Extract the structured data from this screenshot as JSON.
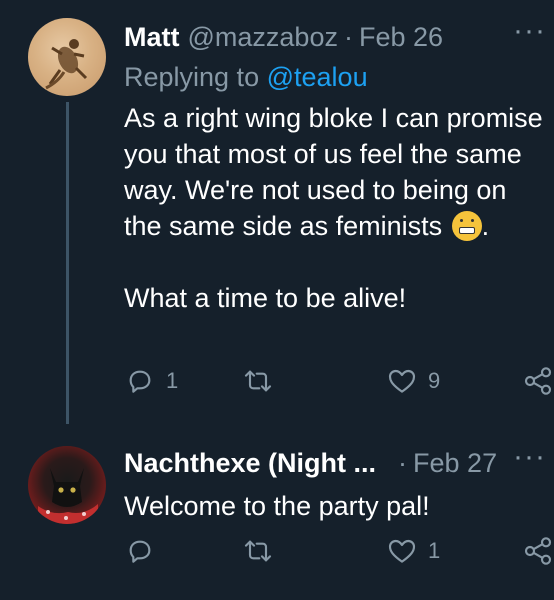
{
  "tweets": [
    {
      "name": "Matt",
      "handle": "@mazzaboz",
      "date": "Feb 26",
      "replying_to_label": "Replying to",
      "replying_to_handle": "@tealou",
      "text_main": "As a right wing bloke I can promise you that most of us feel the same way. We're not used to being on the same side as feminists",
      "text_after_emoji": ".",
      "emoji": "grimacing-face",
      "text_second": "What a time to be alive!",
      "reply_count": "1",
      "retweet_count": "",
      "like_count": "9"
    },
    {
      "name": "Nachthexe (Night ...",
      "handle": "",
      "date": "Feb 27",
      "text": "Welcome to the party pal!",
      "reply_count": "",
      "retweet_count": "",
      "like_count": "1"
    }
  ],
  "more_icon": "···",
  "colors": {
    "background": "#15202b",
    "muted": "#8899a6",
    "link": "#1da1f2",
    "text": "#ffffff"
  }
}
